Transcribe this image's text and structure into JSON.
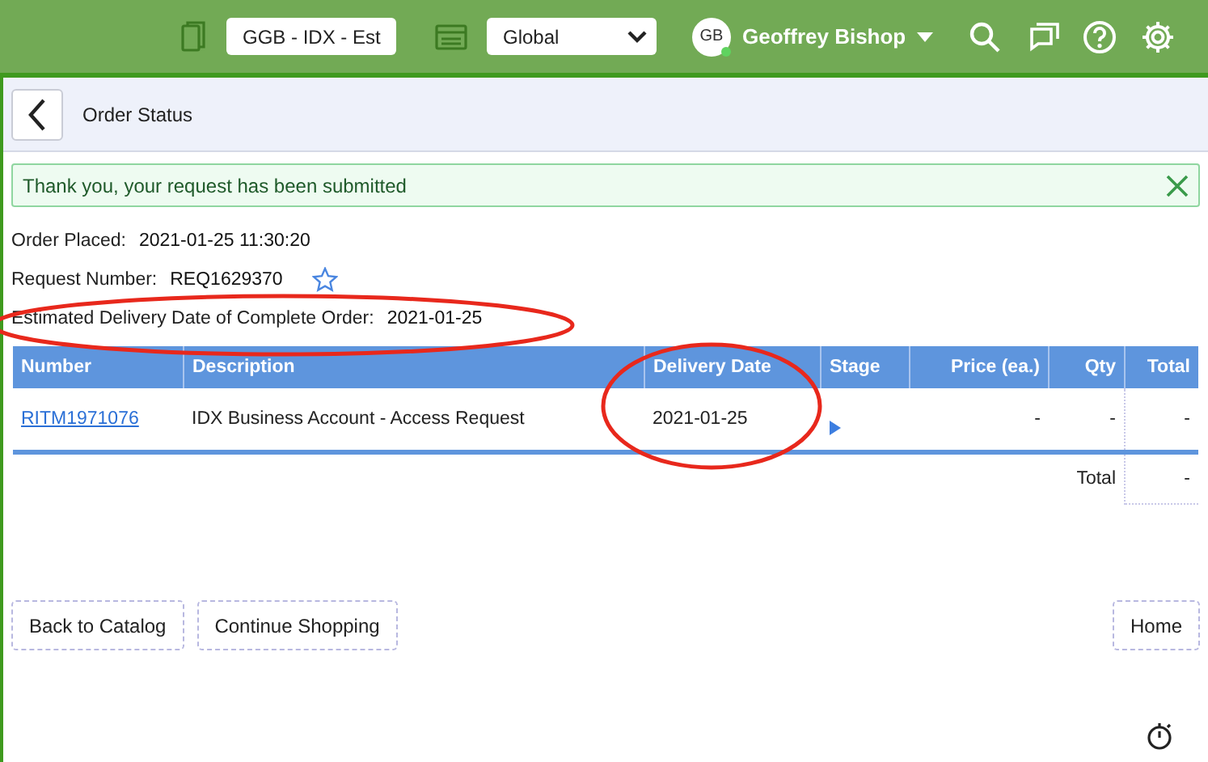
{
  "top_bar": {
    "selectors": [
      {
        "value": "GGB - IDX - Est"
      },
      {
        "value": "Global"
      }
    ],
    "user": {
      "initials": "GB",
      "name": "Geoffrey Bishop",
      "online": true
    }
  },
  "header": {
    "title": "Order Status"
  },
  "alert": {
    "message": "Thank you, your request has been submitted"
  },
  "details": [
    {
      "kind": "plain",
      "label": "Order Placed:",
      "value": "2021-01-25 11:30:20"
    },
    {
      "kind": "request",
      "label": "Request Number:",
      "value": "REQ1629370"
    },
    {
      "kind": "plain",
      "label": "Estimated Delivery Date of Complete Order:",
      "value": "2021-01-25"
    }
  ],
  "table": {
    "columns": [
      "Number",
      "Description",
      "Delivery Date",
      "Stage",
      "Price (ea.)",
      "Qty",
      "Total"
    ],
    "rows": [
      {
        "number": "RITM1971076",
        "description": "IDX Business Account - Access Request",
        "delivery_date": "2021-01-25",
        "price": "-",
        "qty": "-",
        "total": "-"
      }
    ],
    "footer": {
      "label": "Total",
      "value": "-"
    }
  },
  "buttons_left": [
    "Back to Catalog",
    "Continue Shopping"
  ],
  "buttons_right": [
    "Home"
  ]
}
